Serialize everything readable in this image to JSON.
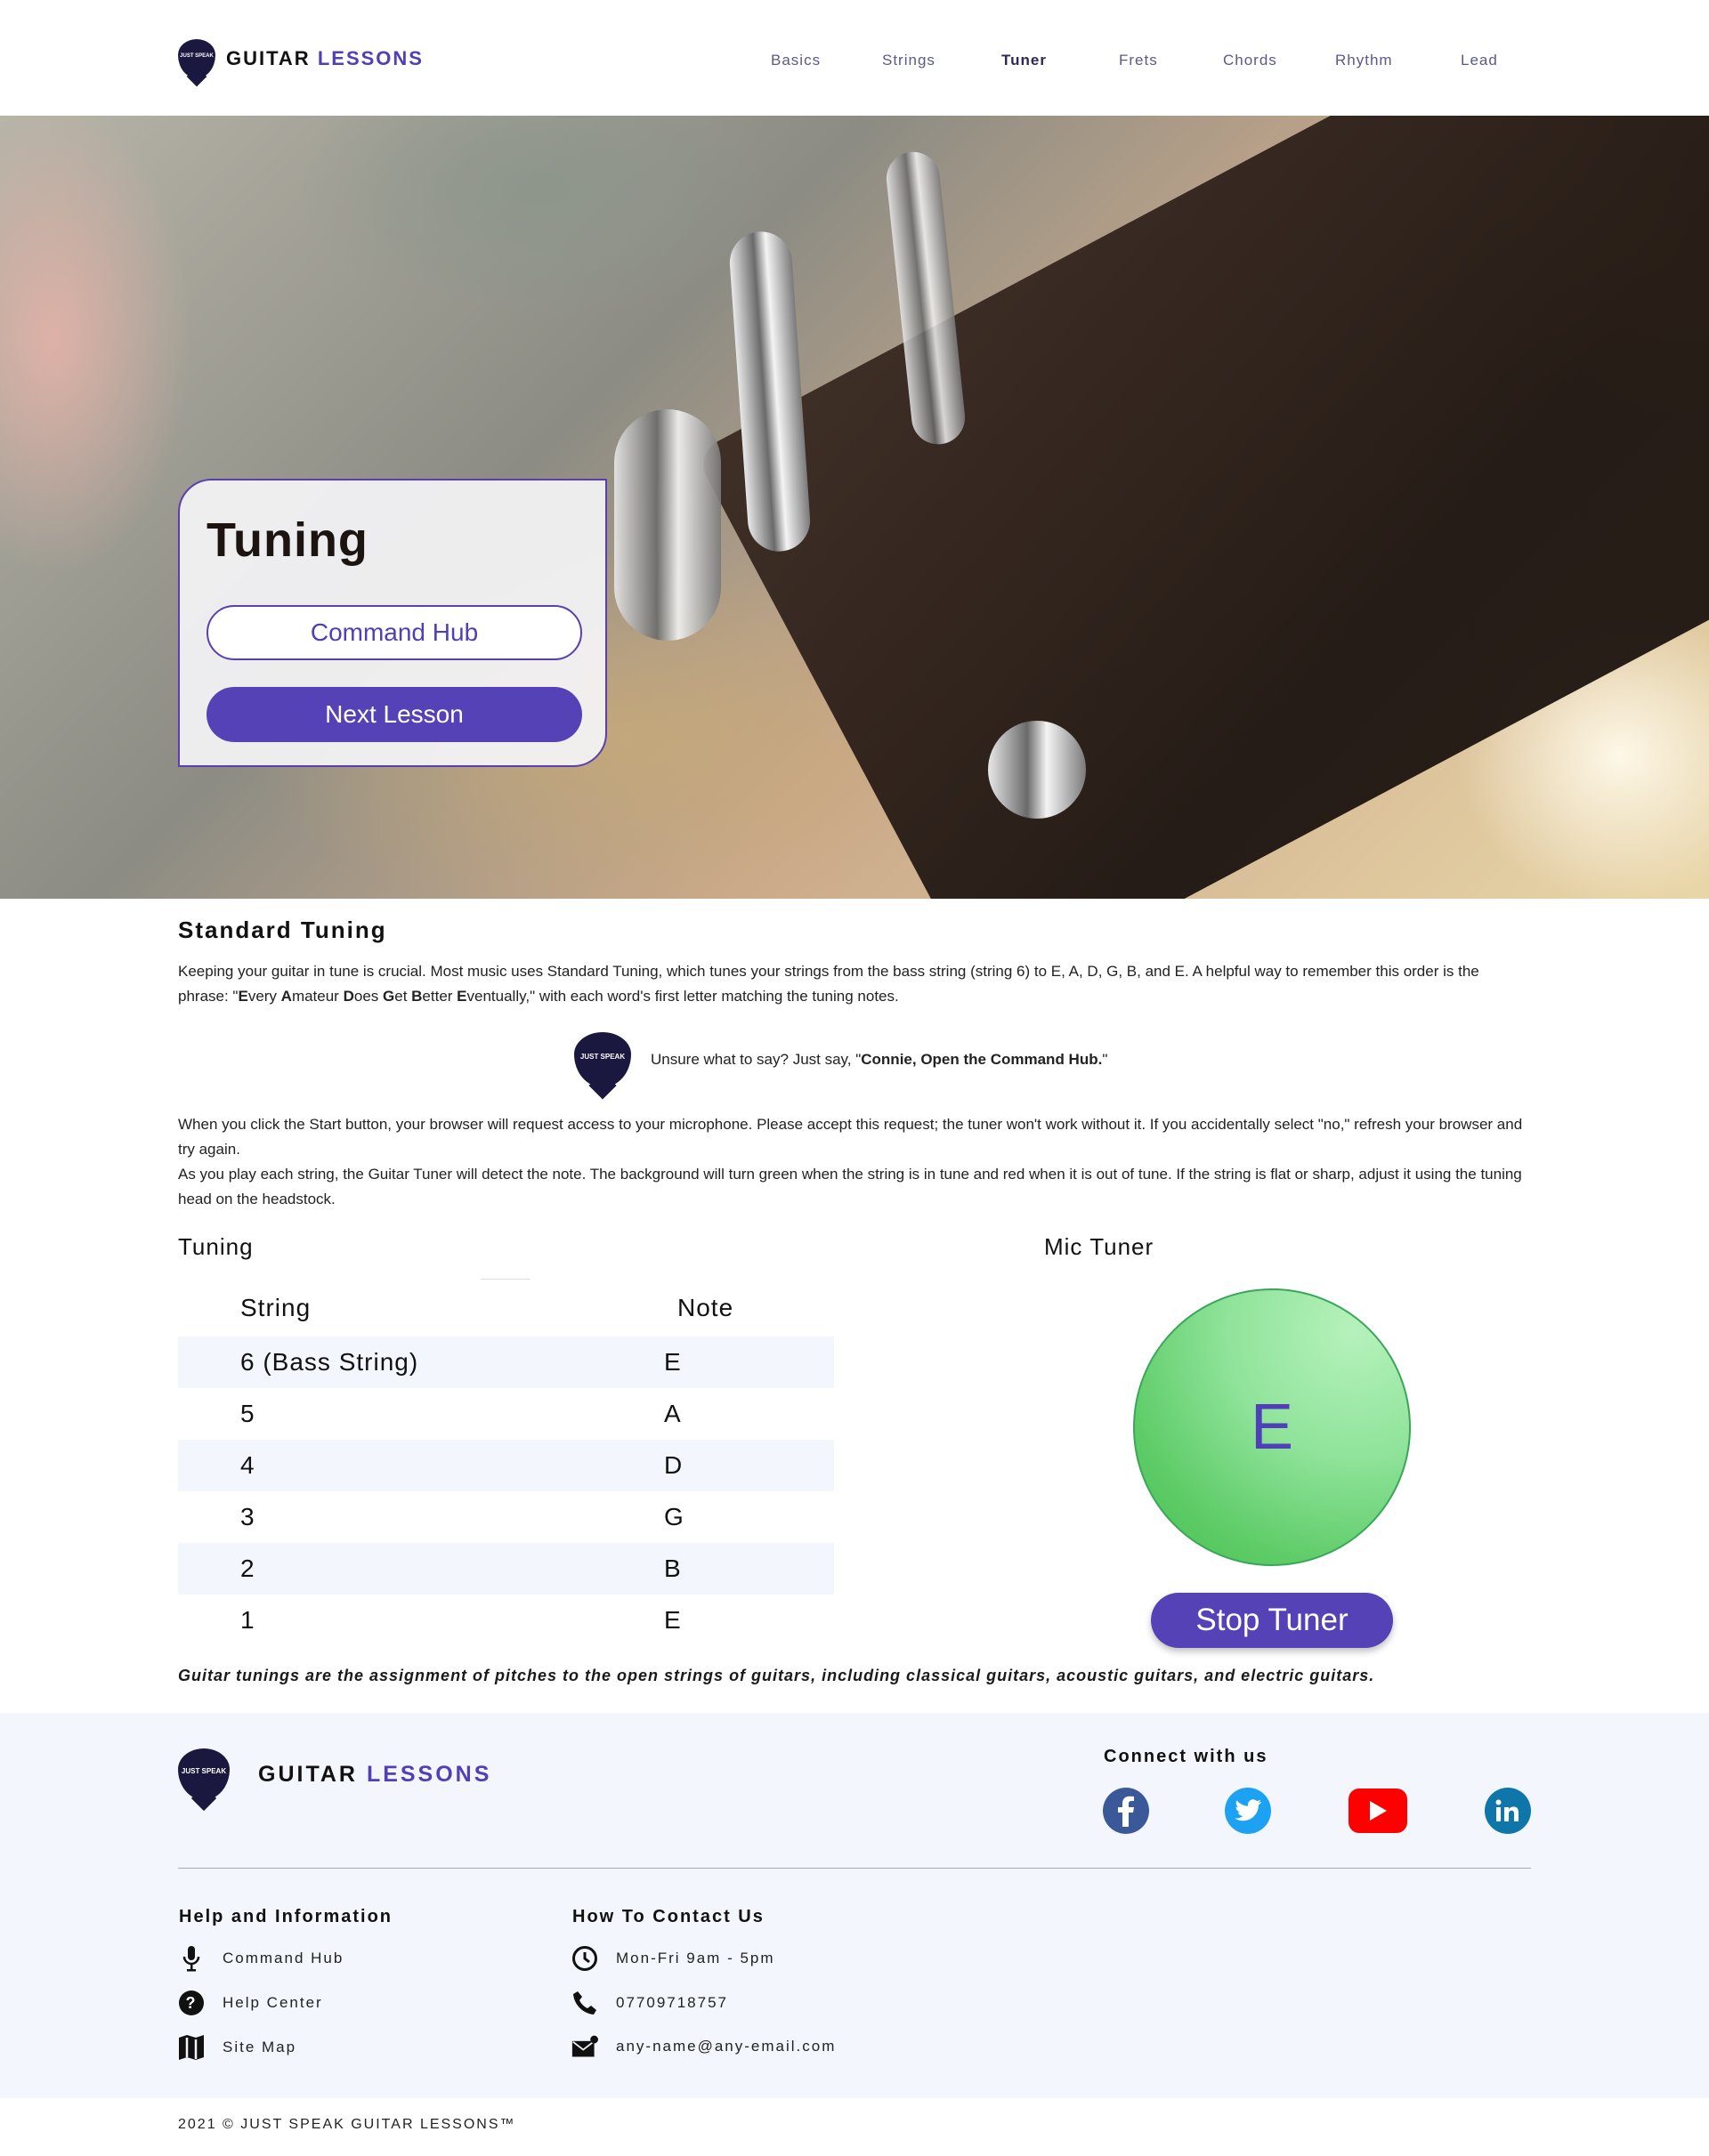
{
  "header": {
    "logo": {
      "pick_text": "JUST SPEAK",
      "title_main": "GUITAR",
      "title_accent": "LESSONS"
    },
    "nav": [
      "Basics",
      "Strings",
      "Tuner",
      "Frets",
      "Chords",
      "Rhythm",
      "Lead"
    ],
    "active_nav": "Tuner"
  },
  "hero": {
    "title": "Tuning",
    "command_hub_label": "Command Hub",
    "next_lesson_label": "Next Lesson"
  },
  "intro": {
    "title": "Standard Tuning",
    "para1_part1": "Keeping your guitar in tune is crucial. Most music uses Standard Tuning, which tunes your strings from the bass string (string 6) to E, A, D, G, B, and E. A helpful way to remember this order is the phrase: \"",
    "mnemonic": [
      {
        "first": "E",
        "rest": "very "
      },
      {
        "first": "A",
        "rest": "mateur "
      },
      {
        "first": "D",
        "rest": "oes "
      },
      {
        "first": "G",
        "rest": "et "
      },
      {
        "first": "B",
        "rest": "etter "
      },
      {
        "first": "E",
        "rest": "ventually"
      }
    ],
    "para1_part2": ",\" with each word's first letter matching the tuning notes.",
    "hint_prefix": "Unsure what to say? Just say, \"",
    "hint_command": "Connie, Open the Command Hub.",
    "hint_suffix": "\"",
    "para2": "When you click the Start button, your browser will request access to your microphone. Please accept this request; the tuner won't work without it. If you accidentally select \"no,\" refresh your browser and try again.",
    "para3": "As you play each string, the Guitar Tuner will detect the note. The background will turn green when the string is in tune and red when it is out of tune. If the string is flat or sharp, adjust it using the tuning head on the headstock."
  },
  "tuning_table": {
    "title": "Tuning",
    "headers": [
      "String",
      "Note"
    ],
    "rows": [
      [
        "6 (Bass String)",
        "E"
      ],
      [
        "5",
        "A"
      ],
      [
        "4",
        "D"
      ],
      [
        "3",
        "G"
      ],
      [
        "2",
        "B"
      ],
      [
        "1",
        "E"
      ]
    ]
  },
  "mic_tuner": {
    "title": "Mic Tuner",
    "current_note": "E",
    "status_color": "#5dcb66",
    "stop_label": "Stop Tuner"
  },
  "note": "Guitar tunings are the assignment of pitches to the open strings of guitars, including classical guitars, acoustic guitars, and electric guitars.",
  "footer": {
    "connect_title": "Connect with us",
    "social": [
      "facebook-icon",
      "twitter-icon",
      "youtube-icon",
      "linkedin-icon"
    ],
    "help_title": "Help and Information",
    "help_items": [
      {
        "icon": "microphone-icon",
        "label": "Command Hub"
      },
      {
        "icon": "help-circle-icon",
        "label": "Help Center"
      },
      {
        "icon": "map-icon",
        "label": "Site Map"
      }
    ],
    "contact_title": "How To Contact Us",
    "contact_items": [
      {
        "icon": "clock-icon",
        "label": "Mon-Fri 9am - 5pm"
      },
      {
        "icon": "phone-icon",
        "label": "07709718757"
      },
      {
        "icon": "mail-icon",
        "label": "any-name@any-email.com"
      }
    ],
    "copyright": "2021 © JUST SPEAK GUITAR LESSONS™"
  },
  "colors": {
    "accent": "#5442b6",
    "accent_text": "#4f3fb8",
    "footer_bg": "#f3f6fc",
    "row_alt": "#f3f6fc"
  }
}
